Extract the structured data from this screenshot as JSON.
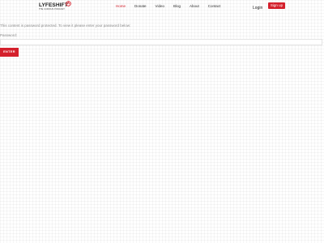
{
  "header": {
    "logo_text": "LYFESHIFT",
    "logo_tagline": "THE CURIOUS PODCAST",
    "nav": [
      {
        "label": "Home",
        "active": true
      },
      {
        "label": "Donate",
        "active": false
      },
      {
        "label": "Video",
        "active": false
      },
      {
        "label": "Blog",
        "active": false
      },
      {
        "label": "About",
        "active": false
      },
      {
        "label": "Contact",
        "active": false
      }
    ],
    "login_label": "Login",
    "signup_label": "Sign up"
  },
  "content": {
    "message": "This content is password protected. To view it please enter your password below:",
    "password_label": "Password:",
    "password_value": "",
    "enter_label": "ENTER"
  },
  "colors": {
    "accent": "#d4202c",
    "muted_text": "#8a8a8a"
  }
}
